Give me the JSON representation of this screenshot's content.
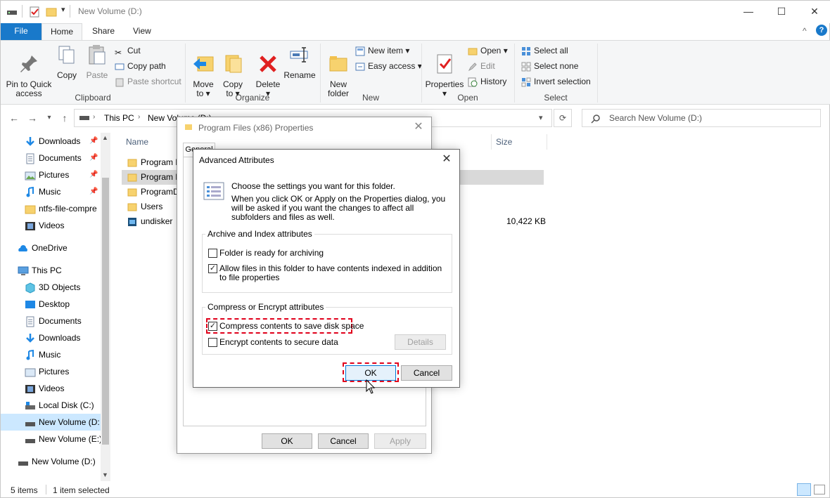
{
  "window": {
    "title": "New Volume (D:)",
    "controls": {
      "minimize": "—",
      "maximize": "☐",
      "close": "✕"
    }
  },
  "ribbon_tabs": [
    "File",
    "Home",
    "Share",
    "View"
  ],
  "ribbon": {
    "clipboard": {
      "label": "Clipboard",
      "pin": "Pin to Quick\naccess",
      "copy": "Copy",
      "paste": "Paste",
      "cut": "Cut",
      "copy_path": "Copy path",
      "paste_shortcut": "Paste shortcut"
    },
    "organize": {
      "label": "Organize",
      "move_to": "Move\nto ▾",
      "copy_to": "Copy\nto ▾",
      "delete": "Delete\n▾",
      "rename": "Rename"
    },
    "new": {
      "label": "New",
      "new_folder": "New\nfolder",
      "new_item": "New item ▾",
      "easy_access": "Easy access ▾"
    },
    "open": {
      "label": "Open",
      "properties": "Properties\n▾",
      "open": "Open ▾",
      "edit": "Edit",
      "history": "History"
    },
    "select": {
      "label": "Select",
      "select_all": "Select all",
      "select_none": "Select none",
      "invert": "Invert selection"
    }
  },
  "address": {
    "path": [
      "This PC",
      "New Volume (D:)"
    ],
    "search_placeholder": "Search New Volume (D:)"
  },
  "nav": {
    "quick": [
      {
        "label": "Downloads",
        "pinned": true
      },
      {
        "label": "Documents",
        "pinned": true
      },
      {
        "label": "Pictures",
        "pinned": true
      },
      {
        "label": "Music",
        "pinned": true
      },
      {
        "label": "ntfs-file-compre",
        "pinned": false
      },
      {
        "label": "Videos",
        "pinned": false
      }
    ],
    "onedrive": "OneDrive",
    "thispc": "This PC",
    "pc_items": [
      "3D Objects",
      "Desktop",
      "Documents",
      "Downloads",
      "Music",
      "Pictures",
      "Videos",
      "Local Disk (C:)",
      "New Volume (D:",
      "New Volume (E:)"
    ],
    "bottom": "New Volume (D:)"
  },
  "files": {
    "col_name": "Name",
    "col_size": "Size",
    "items": [
      {
        "name": "Program F",
        "size": ""
      },
      {
        "name": "Program F",
        "size": ""
      },
      {
        "name": "ProgramD",
        "size": ""
      },
      {
        "name": "Users",
        "size": ""
      },
      {
        "name": "undisker",
        "size": "10,422 KB"
      }
    ]
  },
  "status": {
    "count": "5 items",
    "selected": "1 item selected"
  },
  "properties_dialog": {
    "title": "Program Files (x86) Properties",
    "tab_visible": "General",
    "ok": "OK",
    "cancel": "Cancel",
    "apply": "Apply"
  },
  "advanced_dialog": {
    "title": "Advanced Attributes",
    "intro": "Choose the settings you want for this folder.",
    "intro2": "When you click OK or Apply on the Properties dialog, you will be asked if you want the changes to affect all subfolders and files as well.",
    "archive_group": "Archive and Index attributes",
    "archive_ready": "Folder is ready for archiving",
    "index_allow": "Allow files in this folder to have contents indexed in addition to file properties",
    "compress_group": "Compress or Encrypt attributes",
    "compress": "Compress contents to save disk space",
    "encrypt": "Encrypt contents to secure data",
    "details": "Details",
    "ok": "OK",
    "cancel": "Cancel",
    "checked": {
      "archive": false,
      "index": true,
      "compress": true,
      "encrypt": false
    }
  },
  "colors": {
    "accent": "#1979ca",
    "highlight": "#e0001b",
    "selected_row": "#cce8ff"
  }
}
